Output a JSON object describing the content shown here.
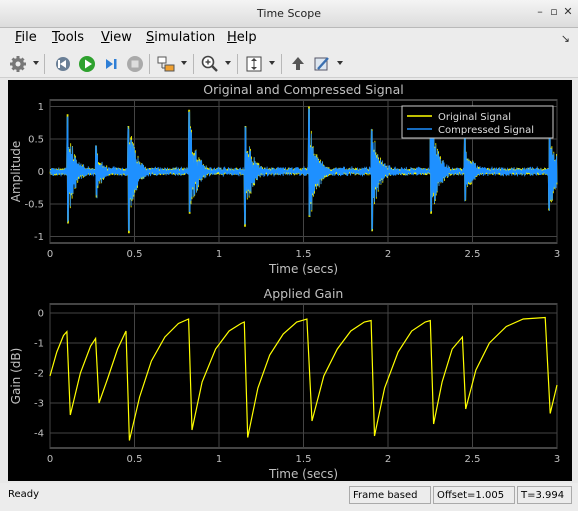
{
  "window": {
    "title": "Time Scope"
  },
  "menu": [
    "File",
    "Tools",
    "View",
    "Simulation",
    "Help"
  ],
  "menu_underline": [
    "F",
    "T",
    "V",
    "S",
    "H"
  ],
  "toolbar_icons": [
    "gear-icon",
    "step-back-icon",
    "run-icon",
    "step-forward-icon",
    "stop-icon",
    "signal-select-icon",
    "zoom-icon",
    "autoscale-icon",
    "highlight-icon",
    "style-icon"
  ],
  "status": {
    "left": "Ready",
    "mode": "Frame based",
    "offset": "Offset=1.005",
    "time": "T=3.994"
  },
  "colors": {
    "original": "#ffff00",
    "compressed": "#1e90ff",
    "axes_bg": "#000000",
    "axes_text": "#c0c0c0"
  },
  "chart_data": [
    {
      "type": "line",
      "title": "Original and Compressed Signal",
      "xlabel": "Time (secs)",
      "ylabel": "Amplitude",
      "xlim": [
        0,
        3
      ],
      "ylim": [
        -1.1,
        1.1
      ],
      "xticks": [
        "0",
        "0.5",
        "1",
        "1.5",
        "2",
        "2.5",
        "3"
      ],
      "yticks": [
        "1",
        "0.5",
        "0",
        "-0.5",
        "-1"
      ],
      "grid": true,
      "legend_position": "top-right",
      "series": [
        {
          "name": "Original Signal",
          "color": "#ffff00"
        },
        {
          "name": "Compressed Signal",
          "color": "#1e90ff"
        }
      ],
      "transients": [
        {
          "t": 0.1,
          "pos": 0.88,
          "neg": -0.8
        },
        {
          "t": 0.27,
          "pos": 0.4,
          "neg": -0.4
        },
        {
          "t": 0.46,
          "pos": 0.7,
          "neg": -0.95
        },
        {
          "t": 0.82,
          "pos": 0.95,
          "neg": -0.65
        },
        {
          "t": 1.15,
          "pos": 0.7,
          "neg": -0.85
        },
        {
          "t": 1.53,
          "pos": 1.0,
          "neg": -0.7
        },
        {
          "t": 1.9,
          "pos": 0.65,
          "neg": -0.92
        },
        {
          "t": 2.25,
          "pos": 0.95,
          "neg": -0.65
        },
        {
          "t": 2.45,
          "pos": 0.55,
          "neg": -0.45
        },
        {
          "t": 2.95,
          "pos": 0.78,
          "neg": -0.6
        }
      ]
    },
    {
      "type": "line",
      "title": "Applied Gain",
      "xlabel": "Time (secs)",
      "ylabel": "Gain (dB)",
      "xlim": [
        0,
        3
      ],
      "ylim": [
        -4.5,
        0.3
      ],
      "xticks": [
        "0",
        "0.5",
        "1",
        "1.5",
        "2",
        "2.5",
        "3"
      ],
      "yticks": [
        "0",
        "-1",
        "-2",
        "-3",
        "-4"
      ],
      "grid": true,
      "series": [
        {
          "name": "",
          "color": "#ffff00",
          "points": [
            [
              0,
              -2.1
            ],
            [
              0.04,
              -1.3
            ],
            [
              0.08,
              -0.75
            ],
            [
              0.1,
              -0.62
            ],
            [
              0.12,
              -3.4
            ],
            [
              0.18,
              -2.0
            ],
            [
              0.24,
              -1.1
            ],
            [
              0.27,
              -0.85
            ],
            [
              0.29,
              -3.0
            ],
            [
              0.34,
              -2.2
            ],
            [
              0.4,
              -1.2
            ],
            [
              0.45,
              -0.6
            ],
            [
              0.47,
              -4.25
            ],
            [
              0.53,
              -2.8
            ],
            [
              0.6,
              -1.6
            ],
            [
              0.68,
              -0.8
            ],
            [
              0.76,
              -0.35
            ],
            [
              0.82,
              -0.2
            ],
            [
              0.84,
              -3.9
            ],
            [
              0.9,
              -2.3
            ],
            [
              0.98,
              -1.2
            ],
            [
              1.06,
              -0.6
            ],
            [
              1.13,
              -0.35
            ],
            [
              1.15,
              -0.3
            ],
            [
              1.17,
              -4.15
            ],
            [
              1.23,
              -2.5
            ],
            [
              1.3,
              -1.4
            ],
            [
              1.38,
              -0.7
            ],
            [
              1.46,
              -0.3
            ],
            [
              1.52,
              -0.2
            ],
            [
              1.55,
              -3.6
            ],
            [
              1.62,
              -2.1
            ],
            [
              1.7,
              -1.2
            ],
            [
              1.78,
              -0.6
            ],
            [
              1.86,
              -0.3
            ],
            [
              1.9,
              -0.25
            ],
            [
              1.92,
              -4.1
            ],
            [
              1.98,
              -2.5
            ],
            [
              2.06,
              -1.3
            ],
            [
              2.14,
              -0.6
            ],
            [
              2.22,
              -0.3
            ],
            [
              2.25,
              -0.25
            ],
            [
              2.27,
              -3.7
            ],
            [
              2.32,
              -2.3
            ],
            [
              2.38,
              -1.2
            ],
            [
              2.44,
              -0.8
            ],
            [
              2.46,
              -3.2
            ],
            [
              2.52,
              -1.9
            ],
            [
              2.6,
              -1.0
            ],
            [
              2.7,
              -0.45
            ],
            [
              2.8,
              -0.2
            ],
            [
              2.93,
              -0.15
            ],
            [
              2.96,
              -3.35
            ],
            [
              3.0,
              -2.4
            ]
          ]
        }
      ]
    }
  ]
}
